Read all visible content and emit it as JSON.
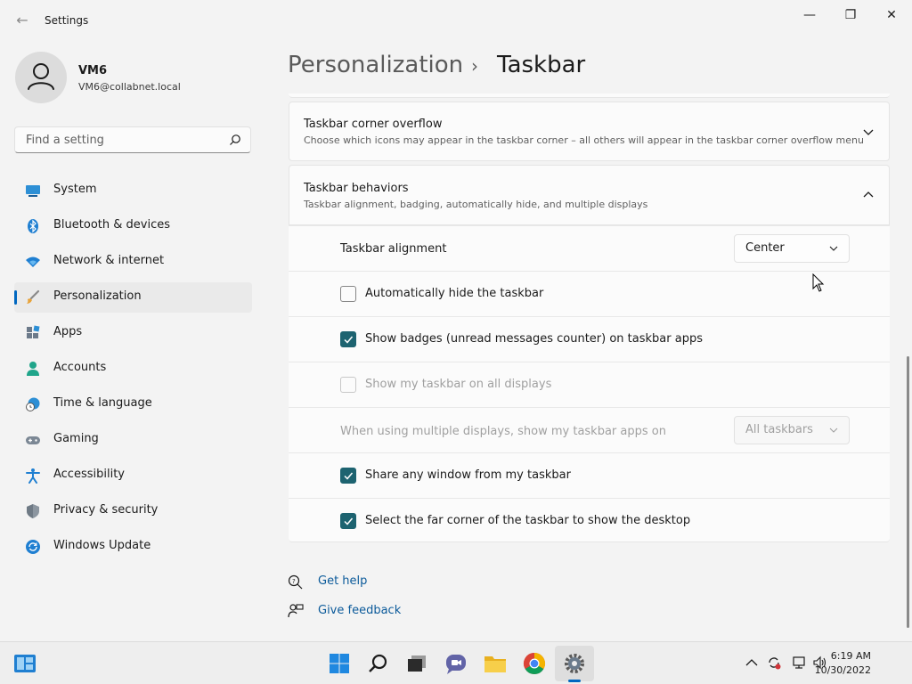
{
  "window": {
    "title": "Settings",
    "back_glyph": "←",
    "minimize_glyph": "—",
    "maximize_glyph": "❐",
    "close_glyph": "✕"
  },
  "profile": {
    "name": "VM6",
    "email": "VM6@collabnet.local"
  },
  "search": {
    "placeholder": "Find a setting",
    "icon": "search-icon"
  },
  "sidebar": {
    "items": [
      {
        "label": "System",
        "icon": "system-display-icon",
        "active": false
      },
      {
        "label": "Bluetooth & devices",
        "icon": "bluetooth-icon",
        "active": false
      },
      {
        "label": "Network & internet",
        "icon": "wifi-icon",
        "active": false
      },
      {
        "label": "Personalization",
        "icon": "paintbrush-icon",
        "active": true
      },
      {
        "label": "Apps",
        "icon": "apps-icon",
        "active": false
      },
      {
        "label": "Accounts",
        "icon": "person-icon",
        "active": false
      },
      {
        "label": "Time & language",
        "icon": "clock-globe-icon",
        "active": false
      },
      {
        "label": "Gaming",
        "icon": "gamepad-icon",
        "active": false
      },
      {
        "label": "Accessibility",
        "icon": "accessibility-icon",
        "active": false
      },
      {
        "label": "Privacy & security",
        "icon": "shield-icon",
        "active": false
      },
      {
        "label": "Windows Update",
        "icon": "update-icon",
        "active": false
      }
    ]
  },
  "header": {
    "parent": "Personalization",
    "separator": "›",
    "current": "Taskbar"
  },
  "sections": {
    "corner_overflow": {
      "title": "Taskbar corner overflow",
      "description": "Choose which icons may appear in the taskbar corner – all others will appear in the taskbar corner overflow menu",
      "expanded": false
    },
    "behaviors": {
      "title": "Taskbar behaviors",
      "description": "Taskbar alignment, badging, automatically hide, and multiple displays",
      "expanded": true,
      "alignment": {
        "label": "Taskbar alignment",
        "value": "Center"
      },
      "auto_hide": {
        "label": "Automatically hide the taskbar",
        "checked": false,
        "enabled": true
      },
      "badges": {
        "label": "Show badges (unread messages counter) on taskbar apps",
        "checked": true,
        "enabled": true
      },
      "all_displays": {
        "label": "Show my taskbar on all displays",
        "checked": false,
        "enabled": false
      },
      "multi_display": {
        "label": "When using multiple displays, show my taskbar apps on",
        "value": "All taskbars",
        "enabled": false
      },
      "share_window": {
        "label": "Share any window from my taskbar",
        "checked": true,
        "enabled": true
      },
      "far_corner": {
        "label": "Select the far corner of the taskbar to show the desktop",
        "checked": true,
        "enabled": true
      }
    }
  },
  "links": {
    "help": "Get help",
    "feedback": "Give feedback"
  },
  "taskbar": {
    "apps": [
      "widgets-icon",
      "start-icon",
      "search-icon",
      "task-view-icon",
      "chat-icon",
      "file-explorer-icon",
      "chrome-icon",
      "settings-icon"
    ],
    "active_app": "settings-icon",
    "time": "6:19 AM",
    "date": "10/30/2022"
  },
  "colors": {
    "accent": "#0067c0",
    "checkbox": "#1d6370",
    "background": "#f3f3f3"
  }
}
